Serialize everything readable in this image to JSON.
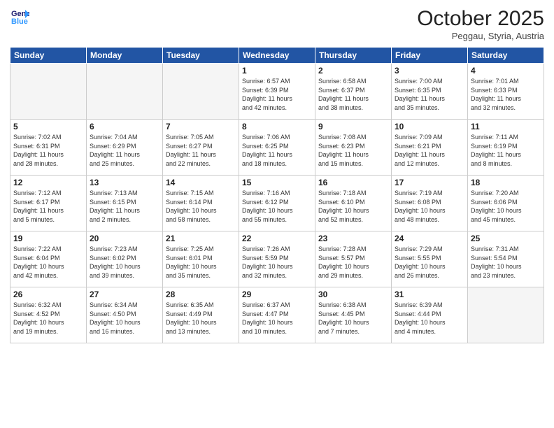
{
  "header": {
    "logo_line1": "General",
    "logo_line2": "Blue",
    "month": "October 2025",
    "location": "Peggau, Styria, Austria"
  },
  "weekdays": [
    "Sunday",
    "Monday",
    "Tuesday",
    "Wednesday",
    "Thursday",
    "Friday",
    "Saturday"
  ],
  "weeks": [
    [
      {
        "day": "",
        "info": ""
      },
      {
        "day": "",
        "info": ""
      },
      {
        "day": "",
        "info": ""
      },
      {
        "day": "1",
        "info": "Sunrise: 6:57 AM\nSunset: 6:39 PM\nDaylight: 11 hours\nand 42 minutes."
      },
      {
        "day": "2",
        "info": "Sunrise: 6:58 AM\nSunset: 6:37 PM\nDaylight: 11 hours\nand 38 minutes."
      },
      {
        "day": "3",
        "info": "Sunrise: 7:00 AM\nSunset: 6:35 PM\nDaylight: 11 hours\nand 35 minutes."
      },
      {
        "day": "4",
        "info": "Sunrise: 7:01 AM\nSunset: 6:33 PM\nDaylight: 11 hours\nand 32 minutes."
      }
    ],
    [
      {
        "day": "5",
        "info": "Sunrise: 7:02 AM\nSunset: 6:31 PM\nDaylight: 11 hours\nand 28 minutes."
      },
      {
        "day": "6",
        "info": "Sunrise: 7:04 AM\nSunset: 6:29 PM\nDaylight: 11 hours\nand 25 minutes."
      },
      {
        "day": "7",
        "info": "Sunrise: 7:05 AM\nSunset: 6:27 PM\nDaylight: 11 hours\nand 22 minutes."
      },
      {
        "day": "8",
        "info": "Sunrise: 7:06 AM\nSunset: 6:25 PM\nDaylight: 11 hours\nand 18 minutes."
      },
      {
        "day": "9",
        "info": "Sunrise: 7:08 AM\nSunset: 6:23 PM\nDaylight: 11 hours\nand 15 minutes."
      },
      {
        "day": "10",
        "info": "Sunrise: 7:09 AM\nSunset: 6:21 PM\nDaylight: 11 hours\nand 12 minutes."
      },
      {
        "day": "11",
        "info": "Sunrise: 7:11 AM\nSunset: 6:19 PM\nDaylight: 11 hours\nand 8 minutes."
      }
    ],
    [
      {
        "day": "12",
        "info": "Sunrise: 7:12 AM\nSunset: 6:17 PM\nDaylight: 11 hours\nand 5 minutes."
      },
      {
        "day": "13",
        "info": "Sunrise: 7:13 AM\nSunset: 6:15 PM\nDaylight: 11 hours\nand 2 minutes."
      },
      {
        "day": "14",
        "info": "Sunrise: 7:15 AM\nSunset: 6:14 PM\nDaylight: 10 hours\nand 58 minutes."
      },
      {
        "day": "15",
        "info": "Sunrise: 7:16 AM\nSunset: 6:12 PM\nDaylight: 10 hours\nand 55 minutes."
      },
      {
        "day": "16",
        "info": "Sunrise: 7:18 AM\nSunset: 6:10 PM\nDaylight: 10 hours\nand 52 minutes."
      },
      {
        "day": "17",
        "info": "Sunrise: 7:19 AM\nSunset: 6:08 PM\nDaylight: 10 hours\nand 48 minutes."
      },
      {
        "day": "18",
        "info": "Sunrise: 7:20 AM\nSunset: 6:06 PM\nDaylight: 10 hours\nand 45 minutes."
      }
    ],
    [
      {
        "day": "19",
        "info": "Sunrise: 7:22 AM\nSunset: 6:04 PM\nDaylight: 10 hours\nand 42 minutes."
      },
      {
        "day": "20",
        "info": "Sunrise: 7:23 AM\nSunset: 6:02 PM\nDaylight: 10 hours\nand 39 minutes."
      },
      {
        "day": "21",
        "info": "Sunrise: 7:25 AM\nSunset: 6:01 PM\nDaylight: 10 hours\nand 35 minutes."
      },
      {
        "day": "22",
        "info": "Sunrise: 7:26 AM\nSunset: 5:59 PM\nDaylight: 10 hours\nand 32 minutes."
      },
      {
        "day": "23",
        "info": "Sunrise: 7:28 AM\nSunset: 5:57 PM\nDaylight: 10 hours\nand 29 minutes."
      },
      {
        "day": "24",
        "info": "Sunrise: 7:29 AM\nSunset: 5:55 PM\nDaylight: 10 hours\nand 26 minutes."
      },
      {
        "day": "25",
        "info": "Sunrise: 7:31 AM\nSunset: 5:54 PM\nDaylight: 10 hours\nand 23 minutes."
      }
    ],
    [
      {
        "day": "26",
        "info": "Sunrise: 6:32 AM\nSunset: 4:52 PM\nDaylight: 10 hours\nand 19 minutes."
      },
      {
        "day": "27",
        "info": "Sunrise: 6:34 AM\nSunset: 4:50 PM\nDaylight: 10 hours\nand 16 minutes."
      },
      {
        "day": "28",
        "info": "Sunrise: 6:35 AM\nSunset: 4:49 PM\nDaylight: 10 hours\nand 13 minutes."
      },
      {
        "day": "29",
        "info": "Sunrise: 6:37 AM\nSunset: 4:47 PM\nDaylight: 10 hours\nand 10 minutes."
      },
      {
        "day": "30",
        "info": "Sunrise: 6:38 AM\nSunset: 4:45 PM\nDaylight: 10 hours\nand 7 minutes."
      },
      {
        "day": "31",
        "info": "Sunrise: 6:39 AM\nSunset: 4:44 PM\nDaylight: 10 hours\nand 4 minutes."
      },
      {
        "day": "",
        "info": ""
      }
    ]
  ]
}
